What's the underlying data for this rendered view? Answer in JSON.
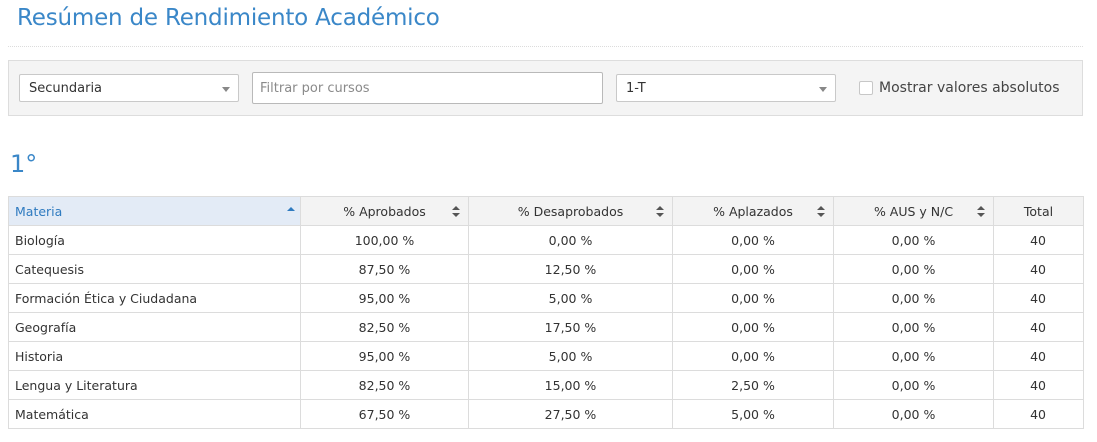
{
  "page": {
    "title": "Resúmen de Rendimiento Académico"
  },
  "filters": {
    "level_value": "Secundaria",
    "course_placeholder": "Filtrar por cursos",
    "division_value": "1-T",
    "absolute_label": "Mostrar valores absolutos",
    "absolute_checked": false
  },
  "section": {
    "title": "1°"
  },
  "table": {
    "headers": {
      "materia": "Materia",
      "aprobados": "% Aprobados",
      "desaprobados": "% Desaprobados",
      "aplazados": "% Aplazados",
      "aus": "% AUS y N/C",
      "total": "Total"
    },
    "sorted_by": "materia",
    "sort_direction": "ascending",
    "rows": [
      {
        "materia": "Biología",
        "aprobados": "100,00 %",
        "desaprobados": "0,00 %",
        "aplazados": "0,00 %",
        "aus": "0,00 %",
        "total": "40"
      },
      {
        "materia": "Catequesis",
        "aprobados": "87,50 %",
        "desaprobados": "12,50 %",
        "aplazados": "0,00 %",
        "aus": "0,00 %",
        "total": "40"
      },
      {
        "materia": "Formación Ética y Ciudadana",
        "aprobados": "95,00 %",
        "desaprobados": "5,00 %",
        "aplazados": "0,00 %",
        "aus": "0,00 %",
        "total": "40"
      },
      {
        "materia": "Geografía",
        "aprobados": "82,50 %",
        "desaprobados": "17,50 %",
        "aplazados": "0,00 %",
        "aus": "0,00 %",
        "total": "40"
      },
      {
        "materia": "Historia",
        "aprobados": "95,00 %",
        "desaprobados": "5,00 %",
        "aplazados": "0,00 %",
        "aus": "0,00 %",
        "total": "40"
      },
      {
        "materia": "Lengua y Literatura",
        "aprobados": "82,50 %",
        "desaprobados": "15,00 %",
        "aplazados": "2,50 %",
        "aus": "0,00 %",
        "total": "40"
      },
      {
        "materia": "Matemática",
        "aprobados": "67,50 %",
        "desaprobados": "27,50 %",
        "aplazados": "5,00 %",
        "aus": "0,00 %",
        "total": "40"
      }
    ]
  },
  "colors": {
    "accent": "#3a87c8",
    "header_active_bg": "#e3ebf6",
    "border": "#dcdcdc"
  }
}
